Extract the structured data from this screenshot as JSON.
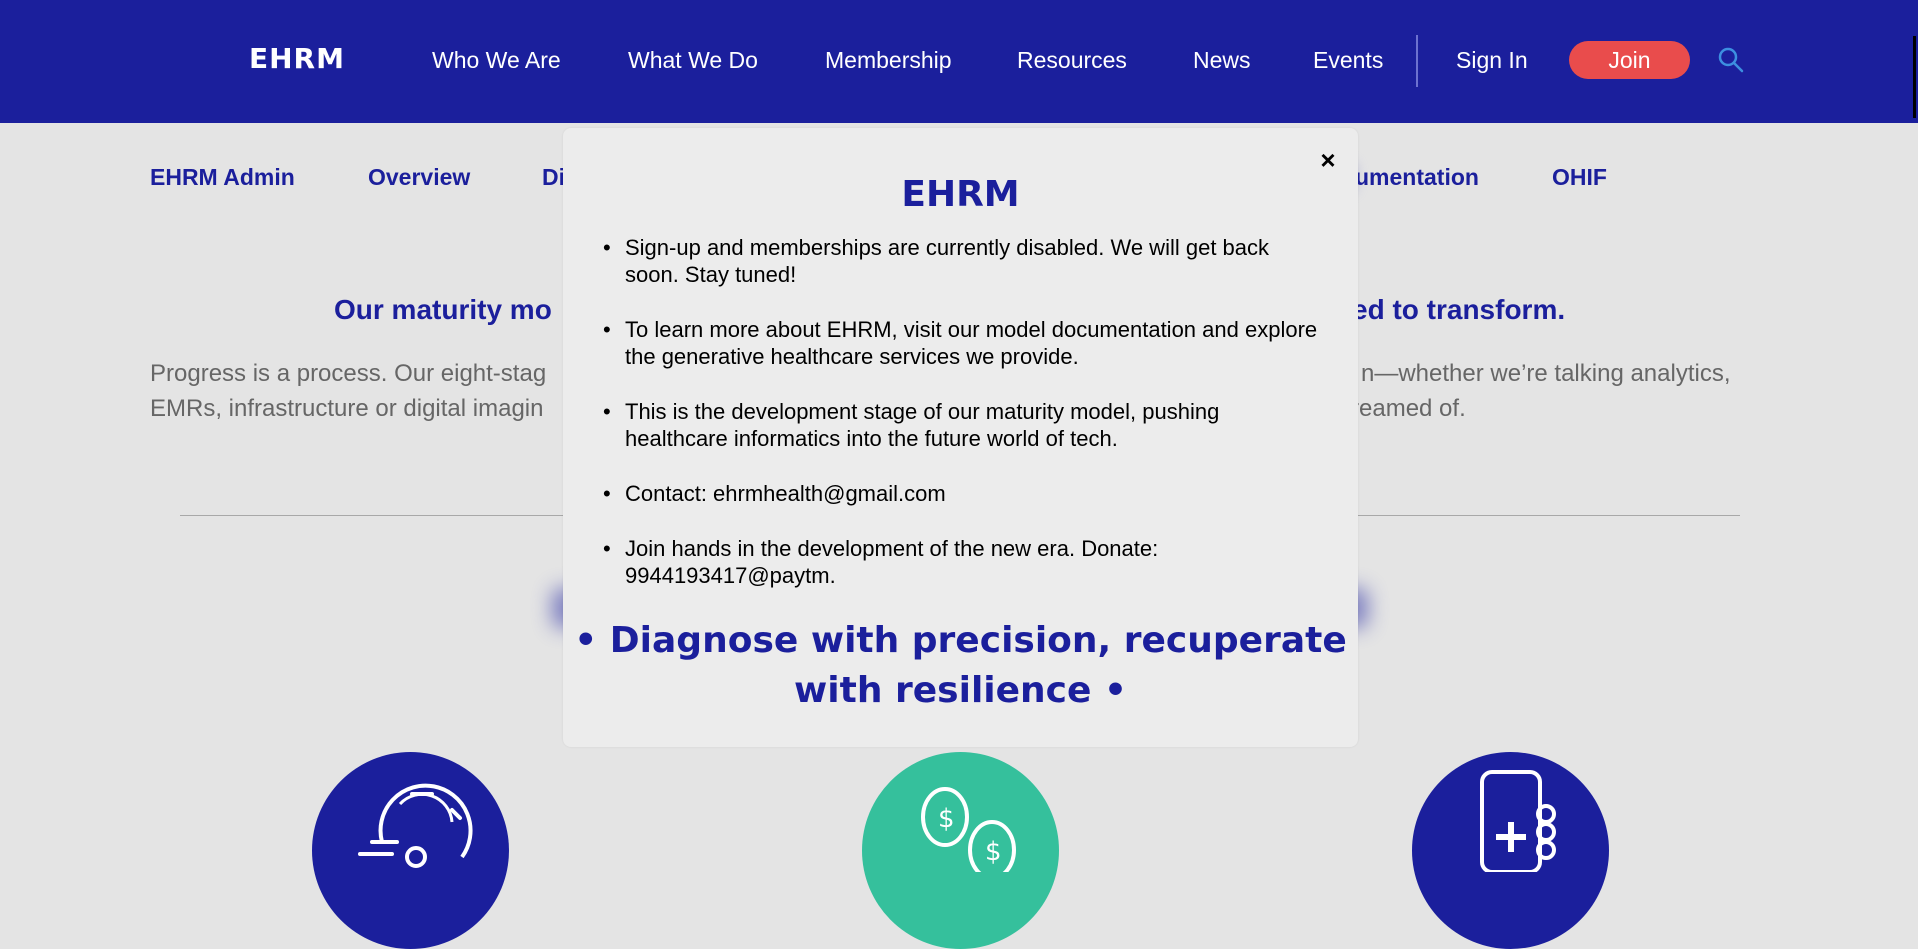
{
  "header": {
    "logo": "EHRM",
    "nav": [
      "Who We Are",
      "What We Do",
      "Membership",
      "Resources",
      "News",
      "Events"
    ],
    "sign_in": "Sign In",
    "join": "Join"
  },
  "subnav": {
    "items": [
      "EHRM Admin",
      "Overview",
      "Di",
      "umentation",
      "OHIF"
    ]
  },
  "background": {
    "heading_left": "Our maturity mo",
    "heading_right": "ed to transform.",
    "para1_left": "Progress is a process. Our eight-stag",
    "para1_right": "n—whether we’re talking analytics,",
    "para2_left": "EMRs, infrastructure or digital imagin",
    "para2_right": "ys dreamed of."
  },
  "modal": {
    "title": "EHRM",
    "close": "×",
    "items": [
      "Sign-up and memberships are currently disabled. We will get back soon. Stay tuned!",
      "To learn more about EHRM, visit our model documentation and explore the generative healthcare services we provide.",
      "This is the development stage of our maturity model, pushing healthcare informatics into the future world of tech.",
      "Contact: ehrmhealth@gmail.com",
      "Join hands in the development of the new era. Donate: 9944193417@paytm."
    ],
    "tagline": "• Diagnose with precision, recuperate with resilience •"
  },
  "colors": {
    "brand_blue": "#1b1f9c",
    "join_red": "#e94c4c",
    "teal": "#35c09c"
  },
  "icons": [
    "search-icon",
    "close-icon",
    "speed-gauge-icon",
    "coins-icon",
    "medical-phone-icon"
  ]
}
